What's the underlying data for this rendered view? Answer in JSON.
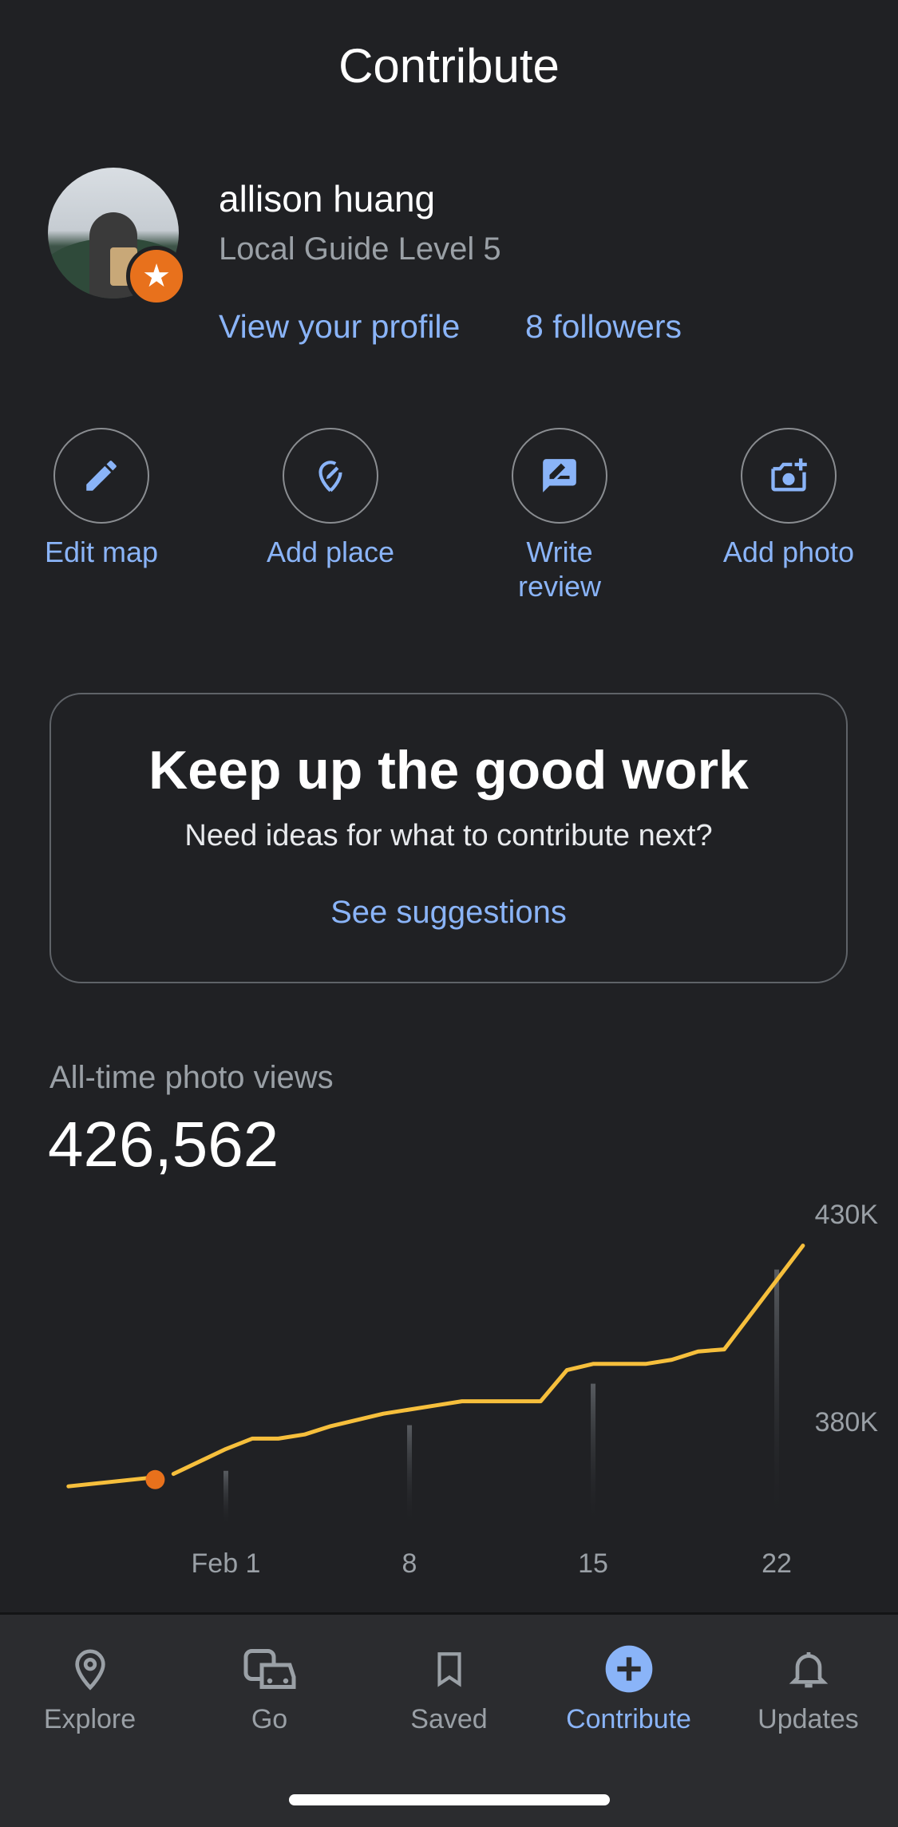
{
  "header": {
    "title": "Contribute"
  },
  "profile": {
    "name": "allison huang",
    "level": "Local Guide Level 5",
    "view_profile_label": "View your profile",
    "followers_label": "8 followers",
    "badge_icon": "star-icon",
    "badge_color": "#e8711c"
  },
  "actions": [
    {
      "label": "Edit map",
      "icon": "pencil-icon"
    },
    {
      "label": "Add place",
      "icon": "add-place-icon"
    },
    {
      "label": "Write review",
      "icon": "write-review-icon"
    },
    {
      "label": "Add photo",
      "icon": "add-photo-icon"
    }
  ],
  "suggestion_card": {
    "title": "Keep up the good work",
    "subtitle": "Need ideas for what to contribute next?",
    "link": "See suggestions"
  },
  "photo_views": {
    "label": "All-time photo views",
    "value": "426,562"
  },
  "chart_data": {
    "type": "line",
    "x_ticks": [
      "Feb 1",
      "8",
      "15",
      "22"
    ],
    "y_ticks": [
      "430K",
      "380K"
    ],
    "ylim": [
      380000,
      430000
    ],
    "series_color": "#f6bf3c",
    "marker_color": "#e8711c",
    "points": [
      {
        "day": -6,
        "value": 369000
      },
      {
        "day": -3,
        "value": 371000
      },
      {
        "day": -2,
        "value": 372000
      },
      {
        "day": 0,
        "value": 378000
      },
      {
        "day": 1,
        "value": 380500
      },
      {
        "day": 2,
        "value": 380500
      },
      {
        "day": 3,
        "value": 381500
      },
      {
        "day": 4,
        "value": 383500
      },
      {
        "day": 6,
        "value": 386500
      },
      {
        "day": 8,
        "value": 388500
      },
      {
        "day": 9,
        "value": 389500
      },
      {
        "day": 12,
        "value": 389500
      },
      {
        "day": 13,
        "value": 397000
      },
      {
        "day": 14,
        "value": 398500
      },
      {
        "day": 16,
        "value": 398500
      },
      {
        "day": 17,
        "value": 399500
      },
      {
        "day": 18,
        "value": 401500
      },
      {
        "day": 19,
        "value": 402000
      },
      {
        "day": 22,
        "value": 427000
      }
    ],
    "marker_day": -3,
    "gap_after_day": -3
  },
  "nav": {
    "items": [
      {
        "label": "Explore",
        "icon": "location-pin-icon",
        "active": false
      },
      {
        "label": "Go",
        "icon": "commute-icon",
        "active": false
      },
      {
        "label": "Saved",
        "icon": "bookmark-icon",
        "active": false
      },
      {
        "label": "Contribute",
        "icon": "add-circle-icon",
        "active": true
      },
      {
        "label": "Updates",
        "icon": "bell-icon",
        "active": false
      }
    ],
    "active_color": "#8ab4f8"
  }
}
